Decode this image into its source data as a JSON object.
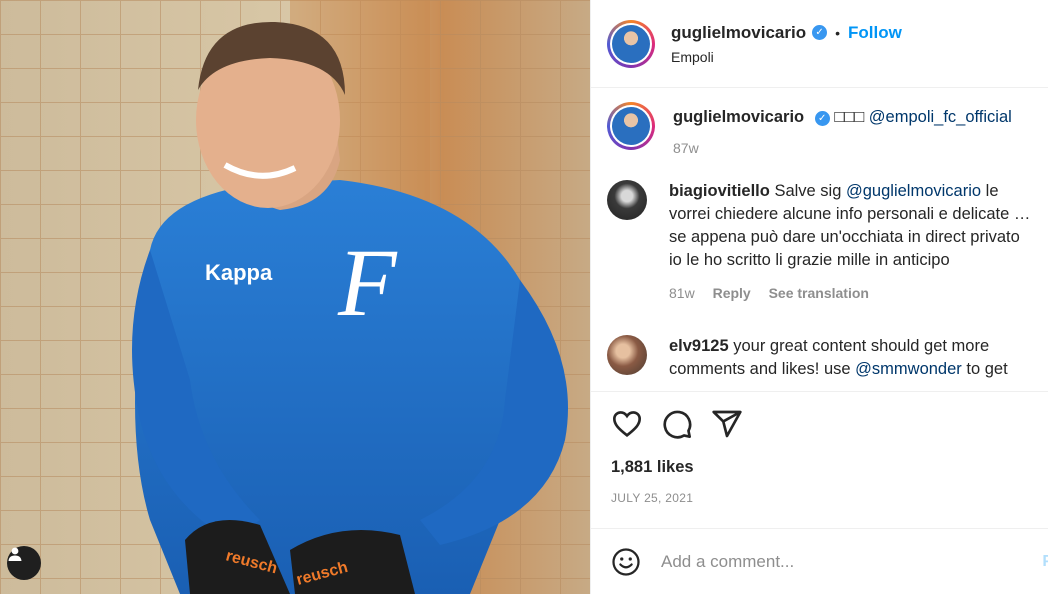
{
  "post": {
    "username": "guglielmovicario",
    "follow_label": "Follow",
    "dot": "•",
    "location": "Empoli",
    "verified_icon": "verified-badge-icon"
  },
  "comments": [
    {
      "username": "guglielmovicario",
      "verified": true,
      "text_prefix": "□□□ ",
      "mention": "@empoli_fc_official",
      "text_suffix": "",
      "time": "87w"
    },
    {
      "username": "biagiovitiello",
      "text_prefix": "Salve sig ",
      "mention": "@guglielmovicario",
      "text_suffix": " le vorrei chiedere alcune info personali e delicate … se appena può dare un'occhiata in direct privato io le ho scritto li grazie mille in anticipo",
      "time": "81w",
      "reply_label": "Reply",
      "translate_label": "See translation"
    },
    {
      "username": "elv9125",
      "text_prefix": "your great content should get more comments and likes! use ",
      "mention": "@smmwonder",
      "text_suffix": " to get"
    }
  ],
  "actions": {
    "like_icon": "heart-icon",
    "comment_icon": "comment-icon",
    "share_icon": "share-icon",
    "likes": "1,881 likes",
    "date": "JULY 25, 2021"
  },
  "add_comment": {
    "placeholder": "Add a comment...",
    "post_label": "P"
  },
  "colors": {
    "accent": "#0095f6",
    "verified": "#3897f0",
    "mention": "#00376b",
    "muted": "#8e8e8e"
  }
}
